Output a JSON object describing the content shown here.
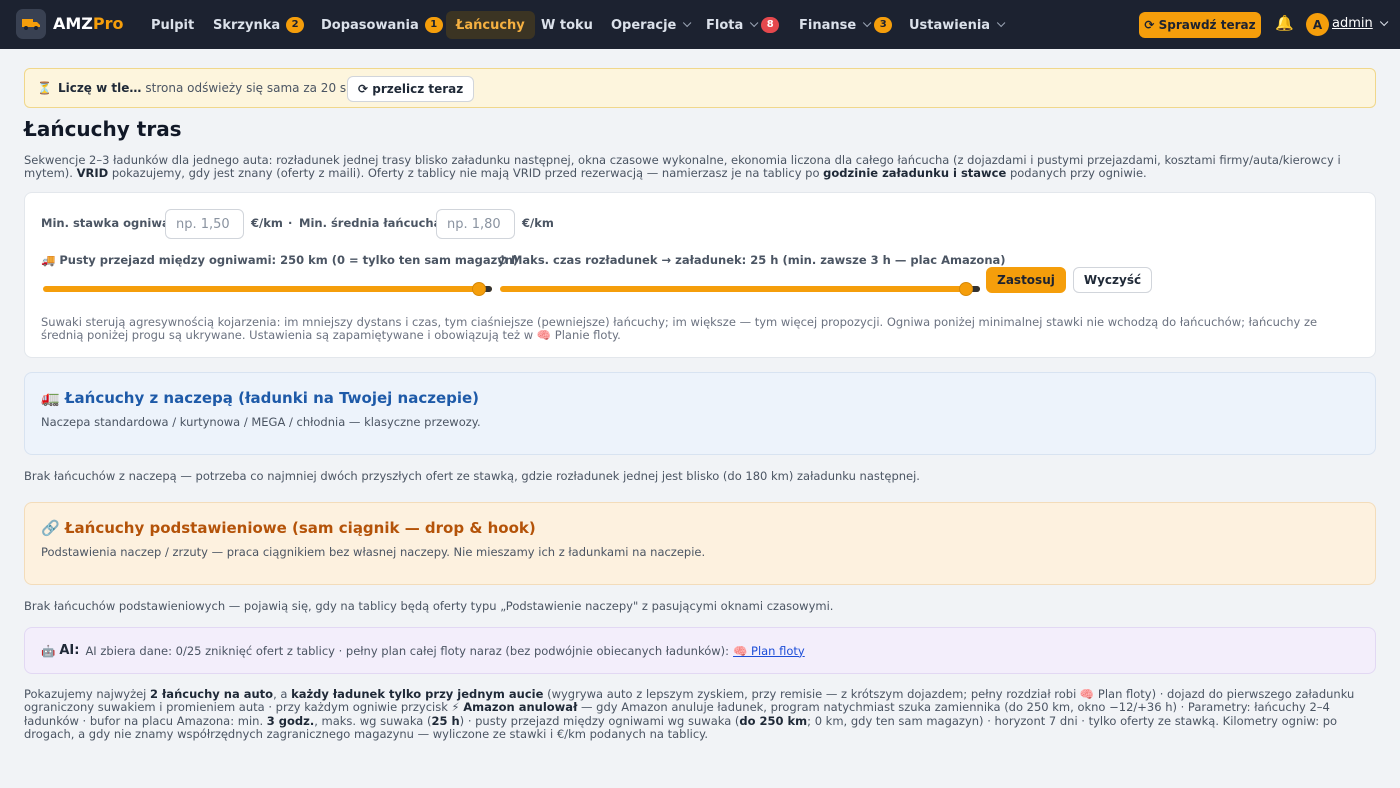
{
  "brand": {
    "name_a": "AMZ",
    "name_b": "Pro"
  },
  "nav": [
    {
      "label": "Pulpit"
    },
    {
      "label": "Skrzynka",
      "badge": "2"
    },
    {
      "label": "Dopasowania",
      "badge": "1"
    },
    {
      "label": "Łańcuchy"
    },
    {
      "label": "W toku"
    },
    {
      "label": "Operacje"
    },
    {
      "label": "Flota",
      "badge": "8"
    },
    {
      "label": "Finanse",
      "badge": "3"
    },
    {
      "label": "Ustawienia"
    }
  ],
  "header": {
    "check_label": "⟳ Sprawdź teraz",
    "avatar_letter": "A",
    "user": "admin"
  },
  "notice": {
    "icon": "⏳",
    "bold": "Liczę w tle…",
    "text": "strona odświeży się sama za 20 s.",
    "button": "⟳ przelicz teraz"
  },
  "page": {
    "title": "Łańcuchy tras",
    "desc_1": "Sekwencje 2–3 ładunków dla jednego auta: rozładunek jednej trasy blisko załadunku następnej, okna czasowe wykonalne, ekonomia liczona dla całego łańcucha (z dojazdami i pustymi przejazdami, kosztami firmy/auta/kierowcy i mytem).",
    "desc_vrid": "VRID",
    "desc_2": "pokazujemy, gdy jest znany (oferty z maili). Oferty z tablicy nie mają VRID przed rezerwacją — namierzasz je na tablicy po",
    "desc_bold": "godzinie załadunku i stawce",
    "desc_3": "podanych przy ogniwie."
  },
  "filters": {
    "min_rate_label": "Min. stawka ogniwa",
    "min_rate_placeholder": "np. 1,50",
    "unit": "€/km",
    "sep": "·",
    "min_avg_label": "Min. średnia łańcucha",
    "min_avg_placeholder": "np. 1,80",
    "empty_label": "🚚 Pusty przejazd między ogniwami: 250 km (0 = tylko ten sam magazyn)",
    "empty_value": 0.97,
    "time_label": "⏱ Maks. czas rozładunek → załadunek: 25 h (min. zawsze 3 h — plac Amazona)",
    "time_value": 0.97,
    "apply": "Zastosuj",
    "clear": "Wyczyść",
    "hint": "Suwaki sterują agresywnością kojarzenia: im mniejszy dystans i czas, tym ciaśniejsze (pewniejsze) łańcuchy; im większe — tym więcej propozycji. Ogniwa poniżej minimalnej stawki nie wchodzą do łańcuchów; łańcuchy ze średnią poniżej progu są ukrywane. Ustawienia są zapamiętywane i obowiązują też w 🧠 Planie floty."
  },
  "trailer": {
    "title": "🚛 Łańcuchy z naczepą (ładunki na Twojej naczepie)",
    "sub": "Naczepa standardowa / kurtynowa / MEGA / chłodnia — klasyczne przewozy.",
    "empty": "Brak łańcuchów z naczepą — potrzeba co najmniej dwóch przyszłych ofert ze stawką, gdzie rozładunek jednej jest blisko (do 180 km) załadunku następnej."
  },
  "drop": {
    "title": "🔗 Łańcuchy podstawieniowe (sam ciągnik — drop & hook)",
    "sub": "Podstawienia naczep / zrzuty — praca ciągnikiem bez własnej naczepy. Nie mieszamy ich z ładunkami na naczepie.",
    "empty": "Brak łańcuchów podstawieniowych — pojawią się, gdy na tablicy będą oferty typu „Podstawienie naczepy\" z pasującymi oknami czasowymi."
  },
  "ai": {
    "icon": "🤖",
    "label": "AI:",
    "text": "AI zbiera dane: 0/25 zniknięć ofert z tablicy · pełny plan całej floty naraz (bez podwójnie obiecanych ładunków):",
    "link": "🧠 Plan floty"
  },
  "footer": {
    "p1": "Pokazujemy najwyżej",
    "b1": "2 łańcuchy na auto",
    "p2": ", a",
    "b2": "każdy ładunek tylko przy jednym aucie",
    "p3": "(wygrywa auto z lepszym zyskiem, przy remisie — z krótszym dojazdem; pełny rozdział robi 🧠 Plan floty) · dojazd do pierwszego załadunku ograniczony suwakiem i promieniem auta · przy każdym ogniwie przycisk ⚡",
    "b3": "Amazon anulował",
    "p4": "— gdy Amazon anuluje ładunek, program natychmiast szuka zamiennika (do 250 km, okno −12/+36 h) · Parametry: łańcuchy 2–4 ładunków · bufor na placu Amazona: min.",
    "b4": "3 godz.",
    "p5": ", maks. wg suwaka (",
    "b5": "25 h",
    "p6": ") · pusty przejazd między ogniwami wg suwaka (",
    "b6": "do 250 km",
    "p7": "; 0 km, gdy ten sam magazyn) · horyzont 7 dni · tylko oferty ze stawką. Kilometry ogniw: po drogach, a gdy nie znamy współrzędnych zagranicznego magazynu — wyliczone ze stawki i €/km podanych na tablicy."
  }
}
